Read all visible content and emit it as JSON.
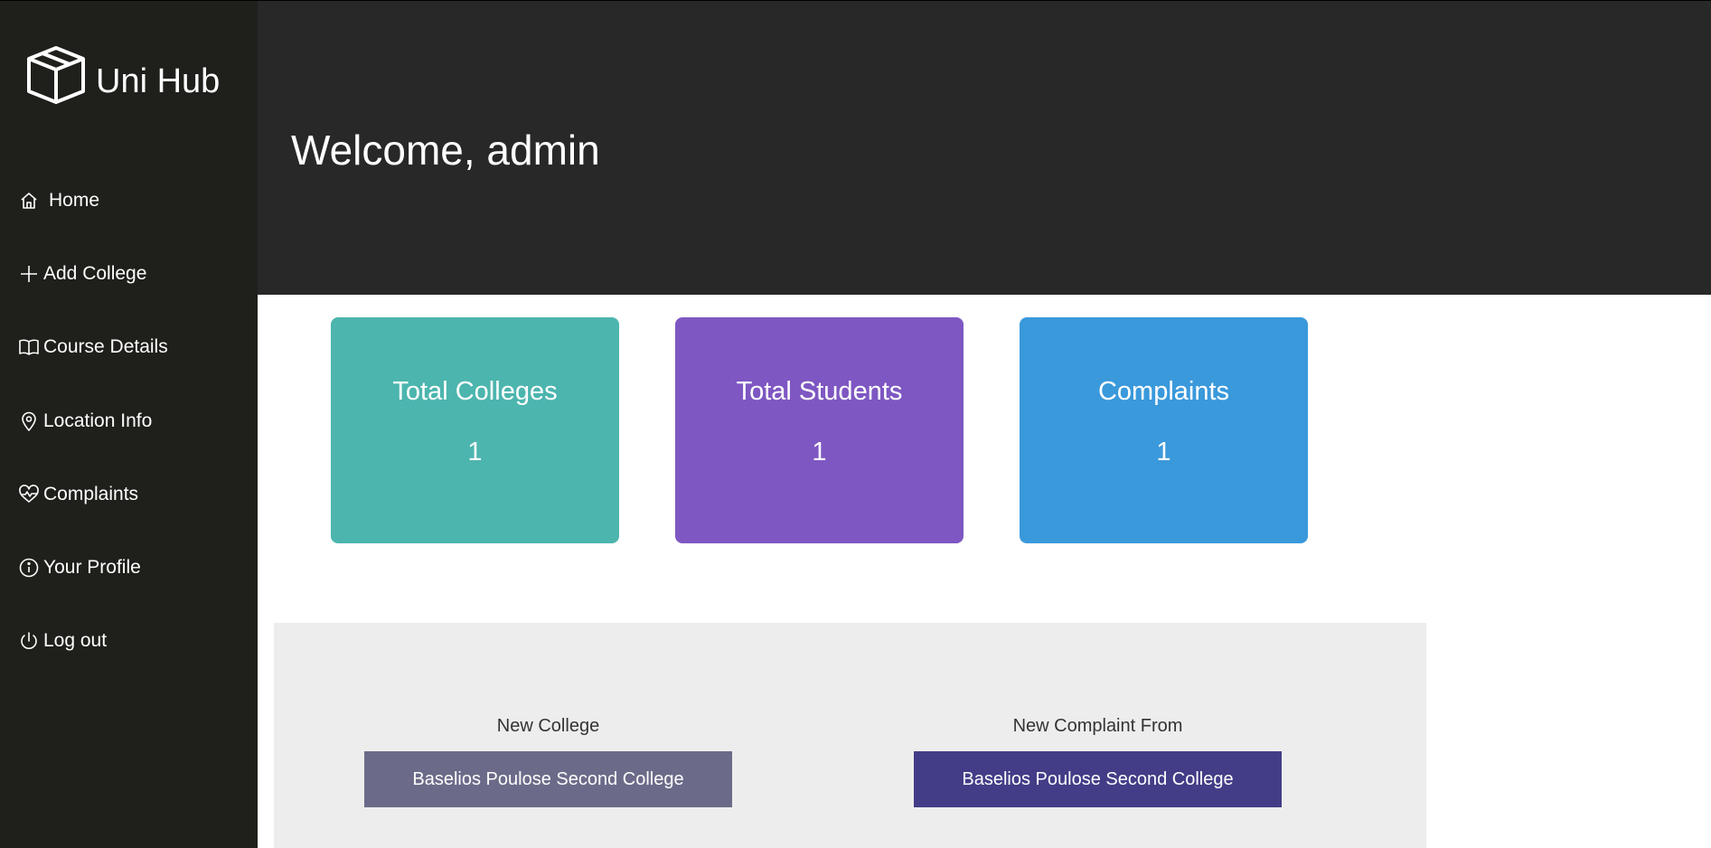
{
  "brand": {
    "name": "Uni Hub",
    "icon": "box-icon"
  },
  "sidebar": {
    "items": [
      {
        "label": "Home",
        "icon": "home-icon"
      },
      {
        "label": "Add College",
        "icon": "plus-icon"
      },
      {
        "label": "Course Details",
        "icon": "book-icon"
      },
      {
        "label": "Location Info",
        "icon": "location-pin-icon"
      },
      {
        "label": "Complaints",
        "icon": "heart-pulse-icon"
      },
      {
        "label": "Your Profile",
        "icon": "info-icon"
      },
      {
        "label": "Log out",
        "icon": "power-icon"
      }
    ]
  },
  "header": {
    "welcome": "Welcome, admin"
  },
  "stats": [
    {
      "title": "Total Colleges",
      "value": "1",
      "color": "#4cb5ae"
    },
    {
      "title": "Total Students",
      "value": "1",
      "color": "#7e57c2"
    },
    {
      "title": "Complaints",
      "value": "1",
      "color": "#3a99db"
    }
  ],
  "recent": {
    "new_college_label": "New College",
    "new_college_name": "Baselios Poulose Second College",
    "new_complaint_label": "New Complaint From",
    "new_complaint_name": "Baselios Poulose Second College"
  },
  "colors": {
    "sidebar_bg": "#1f1f1b",
    "header_bg": "#282828",
    "panel_bg": "#ededed",
    "college_button": "#6b6b89",
    "complaint_button": "#433d87"
  }
}
